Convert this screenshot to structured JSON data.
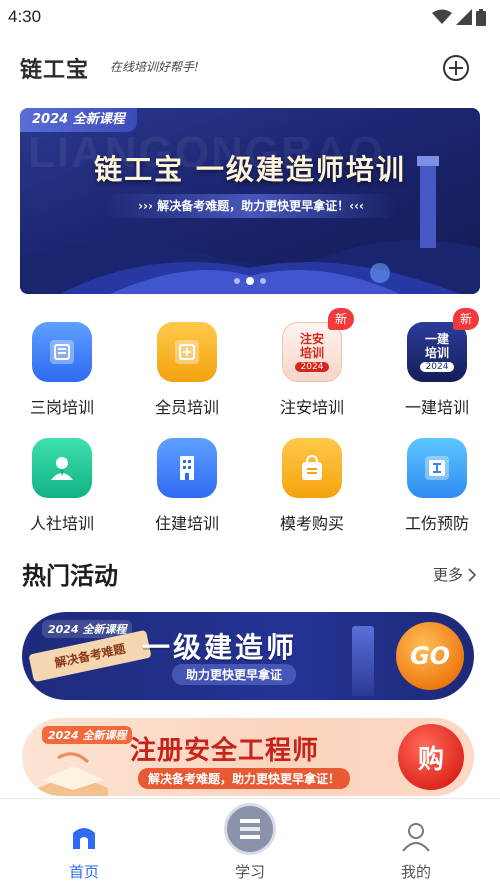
{
  "status_bar": {
    "time": "4:30"
  },
  "header": {
    "logo": "链工宝",
    "slogan": "在线培训好帮手!"
  },
  "banner": {
    "tag": "2024 全新课程",
    "watermark": "LIANGONGBAO",
    "title": "链工宝 一级建造师培训",
    "subtitle": "››› 解决备考难题，助力更快更早拿证！‹‹‹",
    "slides": 3,
    "active_slide": 2
  },
  "grid": [
    {
      "label": "三岗培训",
      "icon": "document-icon",
      "color": "#3d86f5",
      "badge": ""
    },
    {
      "label": "全员培训",
      "icon": "all-staff-icon",
      "color": "#f5b323",
      "badge": ""
    },
    {
      "label": "注安培训",
      "icon_text": "注安\n培训",
      "year": "2024",
      "icon": "safety-course-icon",
      "color": "#f7e6df",
      "badge": "新"
    },
    {
      "label": "一建培训",
      "icon_text": "一建\n培训",
      "year": "2024",
      "icon": "construction-course-icon",
      "color": "#1d2c7a",
      "badge": "新"
    },
    {
      "label": "人社培训",
      "icon": "person-icon",
      "color": "#1ec69a",
      "badge": ""
    },
    {
      "label": "住建培训",
      "icon": "building-icon",
      "color": "#3d86f5",
      "badge": ""
    },
    {
      "label": "模考购买",
      "icon": "shopping-bag-icon",
      "color": "#f5b323",
      "badge": ""
    },
    {
      "label": "工伤预防",
      "icon": "injury-prevention-icon",
      "color": "#3d86f5",
      "badge": ""
    }
  ],
  "hot_activities": {
    "title": "热门活动",
    "more_label": "更多",
    "promos": [
      {
        "tag": "2024 全新课程",
        "title": "一级建造师",
        "subtitle": "助力更快更早拿证",
        "card": "解决备考难题",
        "action": "GO"
      },
      {
        "tag": "2024 全新课程",
        "title": "注册安全工程师",
        "subtitle": "解决备考难题，助力更快更早拿证！",
        "action": "购"
      }
    ]
  },
  "bottom_nav": [
    {
      "label": "首页",
      "icon": "home-icon",
      "active": true
    },
    {
      "label": "学习",
      "icon": "study-icon",
      "active": false
    },
    {
      "label": "我的",
      "icon": "profile-icon",
      "active": false
    }
  ],
  "colors": {
    "accent": "#2f6bf2",
    "badge_red": "#f23a3a"
  }
}
